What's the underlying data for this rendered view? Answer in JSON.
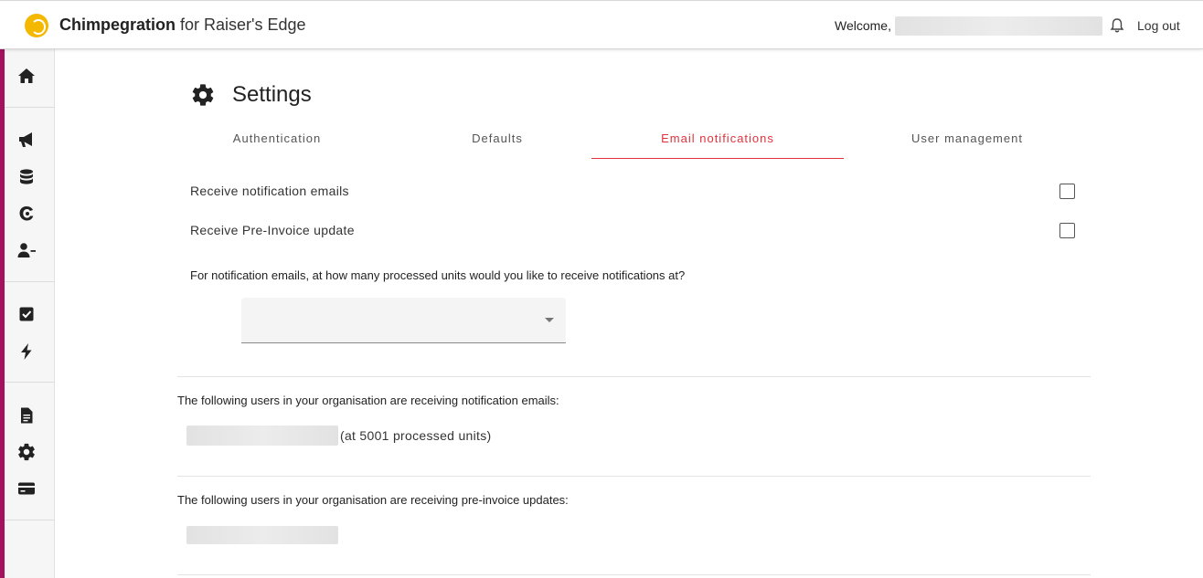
{
  "header": {
    "app_name": "Chimpegration",
    "app_suffix": " for Raiser's Edge",
    "welcome": "Welcome,",
    "logout": "Log out"
  },
  "sidebar": {
    "items": [
      {
        "icon": "home-icon"
      },
      {
        "icon": "megaphone-icon"
      },
      {
        "icon": "database-icon"
      },
      {
        "icon": "mailchimp-icon"
      },
      {
        "icon": "user-minus-icon"
      },
      {
        "icon": "checkbox-icon"
      },
      {
        "icon": "bolt-icon"
      },
      {
        "icon": "document-icon"
      },
      {
        "icon": "gear-icon"
      },
      {
        "icon": "credit-card-icon"
      }
    ],
    "accent_color": "#a3115f"
  },
  "page": {
    "title": "Settings",
    "tabs": [
      {
        "label": "Authentication",
        "active": false
      },
      {
        "label": "Defaults",
        "active": false
      },
      {
        "label": "Email notifications",
        "active": true
      },
      {
        "label": "User management",
        "active": false
      }
    ],
    "active_tab_color": "#e0323c"
  },
  "notifications": {
    "receive_emails_label": "Receive notification emails",
    "receive_emails_checked": false,
    "pre_invoice_label": "Receive Pre-Invoice update",
    "pre_invoice_checked": false,
    "units_question": "For notification emails, at how many processed units would you like to receive notifications at?",
    "units_select_value": "",
    "email_users_heading": "The following users in your organisation are receiving notification emails:",
    "email_users_units": "(at 5001 processed units)",
    "pre_invoice_users_heading": "The following users in your organisation are receiving pre-invoice updates:"
  }
}
